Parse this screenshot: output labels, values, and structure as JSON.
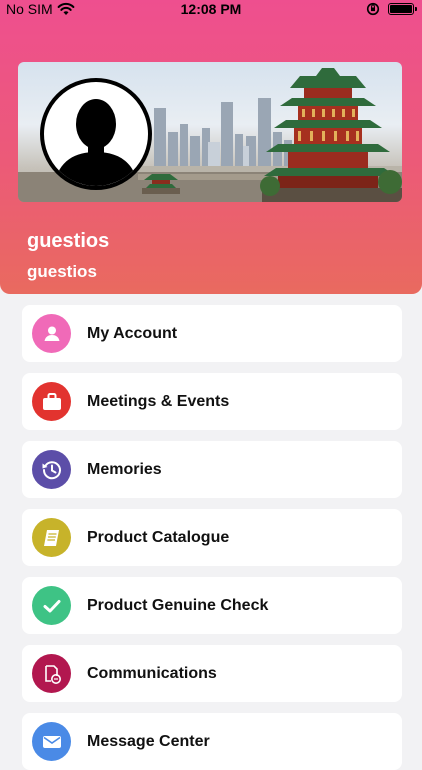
{
  "status_bar": {
    "carrier": "No SIM",
    "time": "12:08 PM"
  },
  "profile": {
    "name": "guestios",
    "subtitle": "guestios"
  },
  "menu": {
    "items": [
      {
        "label": "My Account",
        "icon": "person-icon",
        "color": "#f06ab8"
      },
      {
        "label": "Meetings & Events",
        "icon": "briefcase-icon",
        "color": "#e2332f"
      },
      {
        "label": "Memories",
        "icon": "history-icon",
        "color": "#5c4ea8"
      },
      {
        "label": "Product Catalogue",
        "icon": "book-icon",
        "color": "#c7b32a"
      },
      {
        "label": "Product Genuine Check",
        "icon": "checkmark-icon",
        "color": "#3ec385"
      },
      {
        "label": "Communications",
        "icon": "document-chat-icon",
        "color": "#b2174f"
      },
      {
        "label": "Message Center",
        "icon": "envelope-icon",
        "color": "#4a8ae6"
      }
    ]
  }
}
